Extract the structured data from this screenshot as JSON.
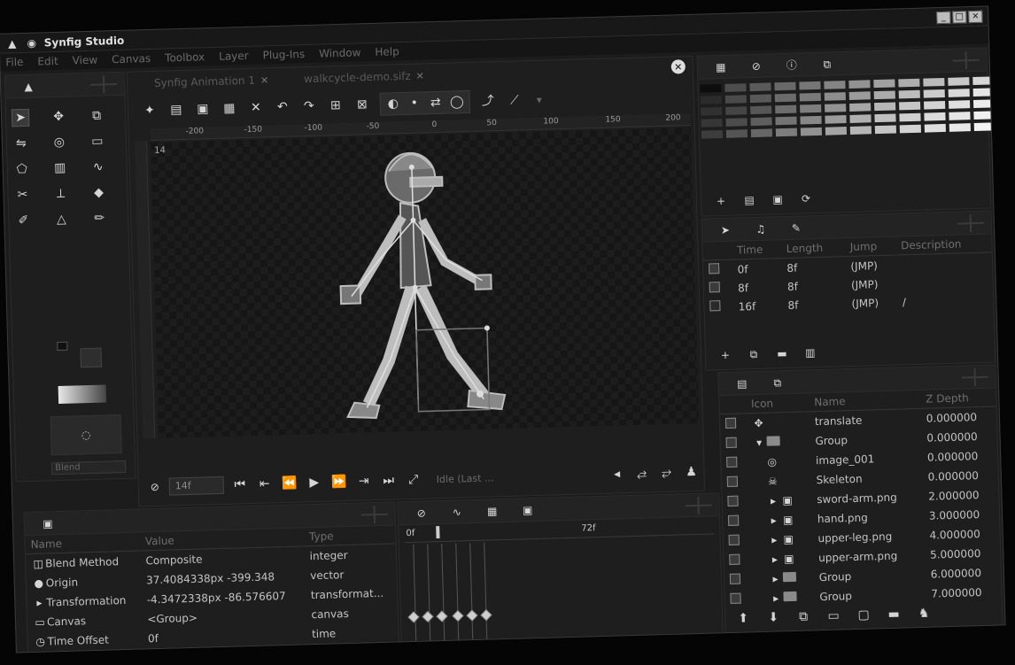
{
  "window": {
    "title": "Synfig Studio",
    "controls": [
      "_",
      "□",
      "×"
    ]
  },
  "menu": [
    "File",
    "Edit",
    "View",
    "Canvas",
    "Toolbox",
    "Layer",
    "Plug-Ins",
    "Window",
    "Help"
  ],
  "document_tabs": [
    {
      "label": "Synfig Animation 1",
      "close": "✕"
    },
    {
      "label": "walkcycle-demo.sifz",
      "close": "✕"
    }
  ],
  "ruler": {
    "ticks": [
      "-200",
      "-150",
      "-100",
      "-50",
      "0",
      "50",
      "100",
      "150",
      "200"
    ]
  },
  "canvas": {
    "frame_number": "14",
    "current_frame_field": "14f",
    "status": "Idle (Last ..."
  },
  "toolbox": {
    "tools": [
      "transform-tool-icon",
      "smooth-move-tool-icon",
      "scale-tool-icon",
      "rotate-tool-icon",
      "mirror-tool-icon",
      "circle-tool-icon",
      "rectangle-tool-icon",
      "star-tool-icon",
      "polygon-tool-icon",
      "gradient-tool-icon",
      "spline-tool-icon",
      "draw-tool-icon",
      "cutout-tool-icon",
      "width-tool-icon",
      "fill-tool-icon",
      "eyedrop-tool-icon",
      "text-tool-icon",
      "sketch-tool-icon",
      "brush-tool-icon",
      "zoom-tool-icon"
    ],
    "blend_method": "Blend"
  },
  "params": {
    "headers": [
      "Name",
      "Value",
      "Type"
    ],
    "rows": [
      {
        "name": "Blend Method",
        "value": "Composite",
        "type": "integer"
      },
      {
        "name": "Origin",
        "value": "37.4084338px   -399.348",
        "type": "vector"
      },
      {
        "name": "Transformation",
        "value": "-4.3472338px   -86.576607",
        "type": "transformat..."
      },
      {
        "name": "Canvas",
        "value": "<Group>",
        "type": "canvas"
      },
      {
        "name": "Time Offset",
        "value": "0f",
        "type": "time"
      }
    ]
  },
  "timetrack": {
    "start_label": "0f",
    "mid_label": "72f"
  },
  "keyframes": {
    "headers": [
      "Time",
      "Length",
      "Jump",
      "Description"
    ],
    "rows": [
      {
        "time": "0f",
        "length": "8f",
        "jump": "(JMP)",
        "description": ""
      },
      {
        "time": "8f",
        "length": "8f",
        "jump": "(JMP)",
        "description": ""
      },
      {
        "time": "16f",
        "length": "8f",
        "jump": "(JMP)",
        "description": "/"
      }
    ]
  },
  "layers": {
    "headers": [
      "Icon",
      "Name",
      "Z Depth"
    ],
    "rows": [
      {
        "name": "translate",
        "z": "0.000000",
        "indent": 0,
        "folder": false,
        "icon": "transform-icon"
      },
      {
        "name": "Group",
        "z": "0.000000",
        "indent": 0,
        "folder": true,
        "icon": "folder-icon"
      },
      {
        "name": "image_001",
        "z": "0.000000",
        "indent": 1,
        "folder": false,
        "icon": "circle-icon"
      },
      {
        "name": "Skeleton",
        "z": "0.000000",
        "indent": 1,
        "folder": false,
        "icon": "skeleton-icon"
      },
      {
        "name": "sword-arm.png",
        "z": "2.000000",
        "indent": 1,
        "folder": true,
        "icon": "image-icon"
      },
      {
        "name": "hand.png",
        "z": "3.000000",
        "indent": 1,
        "folder": true,
        "icon": "image-icon"
      },
      {
        "name": "upper-leg.png",
        "z": "4.000000",
        "indent": 1,
        "folder": true,
        "icon": "image-icon"
      },
      {
        "name": "upper-arm.png",
        "z": "5.000000",
        "indent": 1,
        "folder": true,
        "icon": "image-icon"
      },
      {
        "name": "Group",
        "z": "6.000000",
        "indent": 1,
        "folder": true,
        "icon": "folder-icon"
      },
      {
        "name": "Group",
        "z": "7.000000",
        "indent": 1,
        "folder": true,
        "icon": "folder-icon"
      }
    ]
  },
  "palette": {
    "colors": [
      "#0d0d0d",
      "#4d4d4d",
      "#5a5a5a",
      "#686868",
      "#767676",
      "#848484",
      "#929292",
      "#a0a0a0",
      "#adadad",
      "#bbbbbb",
      "#c8c8c8",
      "#d6d6d6",
      "#2b2b2b",
      "#4a4a4a",
      "#595959",
      "#6b6b6b",
      "#7a7a7a",
      "#8d8d8d",
      "#9b9b9b",
      "#ababab",
      "#bcbcbc",
      "#cbcbcb",
      "#d9d9d9",
      "#e6e6e6",
      "#313131",
      "#454545",
      "#575757",
      "#6d6d6d",
      "#7f7f7f",
      "#939393",
      "#a6a6a6",
      "#b7b7b7",
      "#c6c6c6",
      "#d4d4d4",
      "#e0e0e0",
      "#ebebeb",
      "#363636",
      "#4c4c4c",
      "#5e5e5e",
      "#747474",
      "#888888",
      "#9c9c9c",
      "#afafaf",
      "#c0c0c0",
      "#cfcfcf",
      "#dcdcdc",
      "#e6e6e6",
      "#f0f0f0",
      "#3d3d3d",
      "#545454",
      "#676767",
      "#7d7d7d",
      "#919191",
      "#a4a4a4",
      "#b5b5b5",
      "#c5c5c5",
      "#d3d3d3",
      "#dfdfdf",
      "#e9e9e9",
      "#f3f3f3"
    ]
  }
}
